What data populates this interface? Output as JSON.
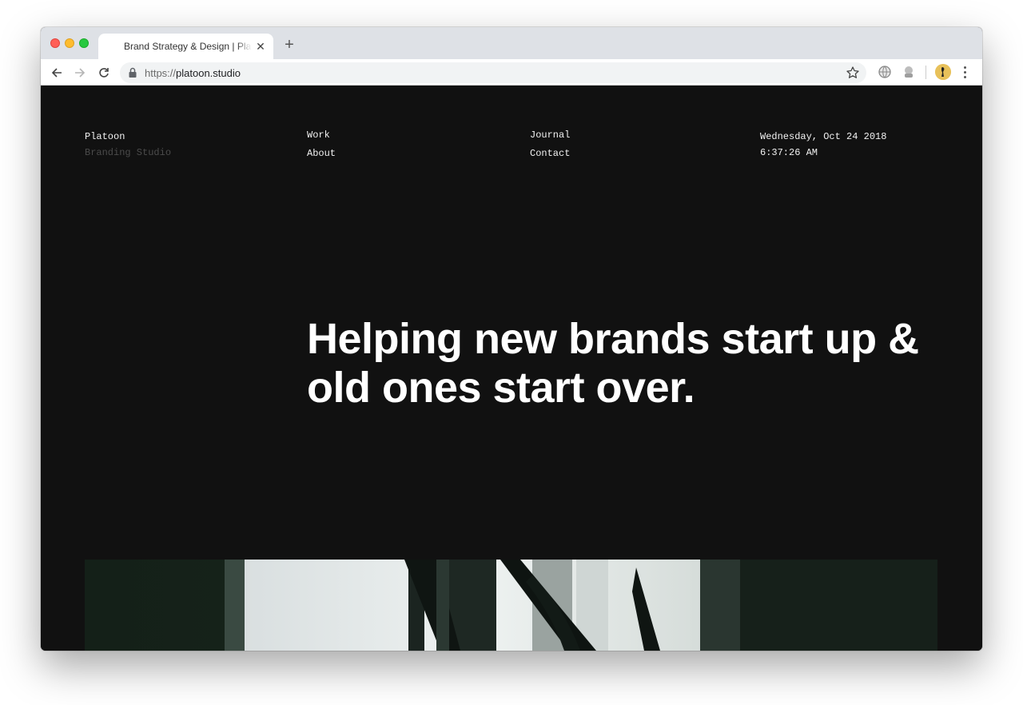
{
  "browser": {
    "tab_title": "Brand Strategy & Design | Platoon",
    "tab_close": "✕",
    "new_tab": "+",
    "url_protocol": "https://",
    "url_host": "platoon.studio"
  },
  "site": {
    "brand": "Platoon",
    "tagline": "Branding Studio",
    "nav": {
      "work": "Work",
      "about": "About",
      "journal": "Journal",
      "contact": "Contact"
    },
    "date": "Wednesday, Oct 24 2018",
    "time": "6:37:26 AM",
    "hero_line1": "Helping new brands start up &",
    "hero_line2": "old ones start over."
  },
  "icons": {
    "back": "arrow-left-icon",
    "forward": "arrow-right-icon",
    "reload": "reload-icon",
    "lock": "lock-icon",
    "bookmark": "star-icon",
    "ext1": "globe-icon",
    "ext2": "extension-icon",
    "menu": "kebab-menu-icon"
  },
  "colors": {
    "page_bg": "#111111",
    "text": "#f2f2f2",
    "tagline": "#4b4b4b"
  }
}
